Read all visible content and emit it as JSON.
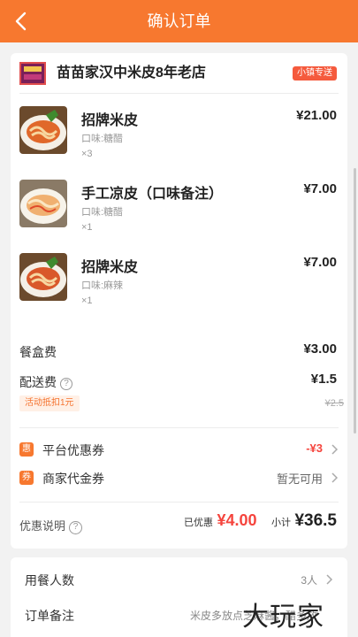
{
  "header": {
    "title": "确认订单"
  },
  "shop": {
    "name": "苗苗家汉中米皮8年老店",
    "badge": "小镇专送"
  },
  "items": [
    {
      "name": "招牌米皮",
      "flavor": "口味:糖醋",
      "qty": "×3",
      "price": "¥21.00"
    },
    {
      "name": "手工凉皮（口味备注）",
      "flavor": "口味:糖醋",
      "qty": "×1",
      "price": "¥7.00"
    },
    {
      "name": "招牌米皮",
      "flavor": "口味:麻辣",
      "qty": "×1",
      "price": "¥7.00"
    }
  ],
  "fees": {
    "box_label": "餐盒费",
    "box_value": "¥3.00",
    "delivery_label": "配送费",
    "delivery_value": "¥1.5",
    "delivery_discount": "活动抵扣1元",
    "delivery_original": "¥2.5"
  },
  "coupons": {
    "platform_icon": "惠",
    "platform_label": "平台优惠券",
    "platform_value": "-¥3",
    "merchant_icon": "券",
    "merchant_label": "商家代金券",
    "merchant_value": "暂无可用"
  },
  "summary": {
    "label": "优惠说明",
    "saved_label": "已优惠",
    "saved_value": "¥4.00",
    "subtotal_label": "小计",
    "subtotal_value": "¥36.5"
  },
  "extra": {
    "diners_label": "用餐人数",
    "diners_value": "3人",
    "remark_label": "订单备注",
    "remark_value": "米皮多放点芝麻酱，醋多放"
  },
  "watermark": "大玩家",
  "colors": {
    "accent": "#f7782f",
    "price_red": "#f5443d"
  }
}
